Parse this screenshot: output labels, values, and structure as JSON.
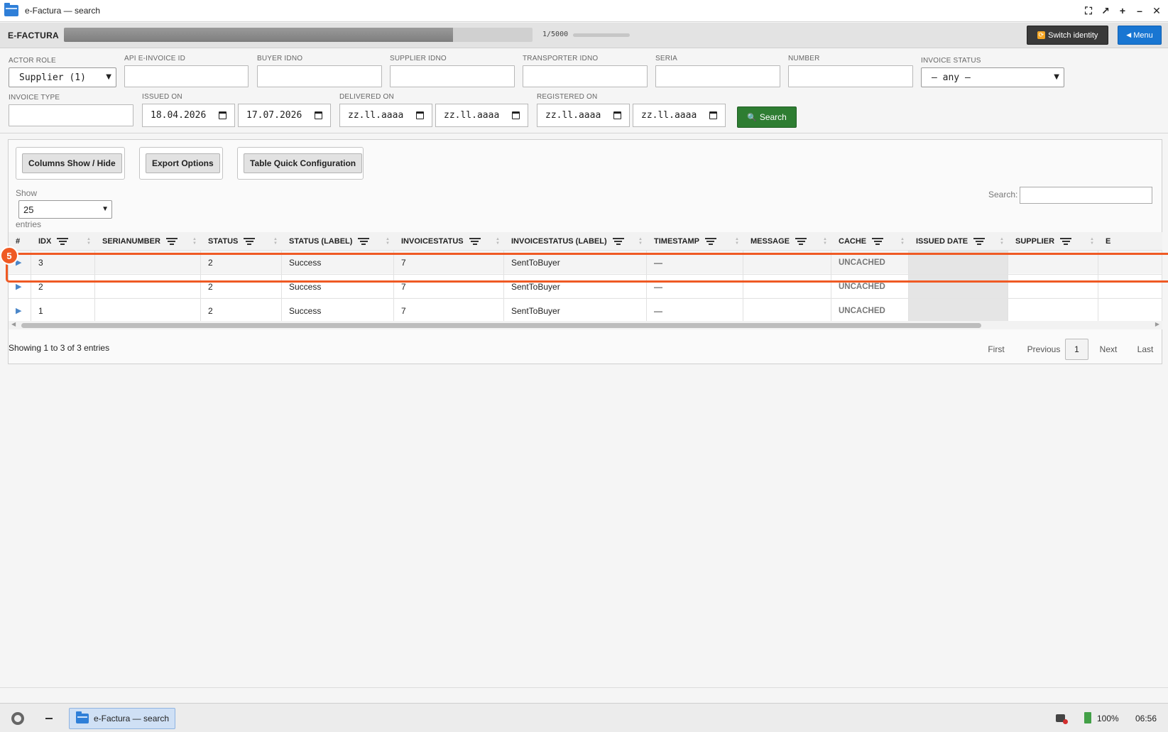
{
  "window": {
    "title": "e-Factura — search"
  },
  "appbar": {
    "brand": "E-FACTURA",
    "progress_fraction": 0.83,
    "counter": "1/5000",
    "switch_label": "Switch identity",
    "menu_label": "Menu"
  },
  "filters": {
    "actor_role": {
      "label": "ACTOR ROLE",
      "value": "Supplier (1)"
    },
    "api_invoice_id": {
      "label": "API E-INVOICE ID"
    },
    "buyer_idno": {
      "label": "BUYER IDNO"
    },
    "supplier_idno": {
      "label": "SUPPLIER IDNO"
    },
    "transporter_idno": {
      "label": "TRANSPORTER IDNO"
    },
    "seria": {
      "label": "SERIA"
    },
    "number": {
      "label": "NUMBER"
    },
    "invoice_status": {
      "label": "INVOICE STATUS",
      "value": "— any —"
    },
    "invoice_type": {
      "label": "INVOICE TYPE"
    },
    "issued_on": {
      "label": "ISSUED ON",
      "from": "18.04.2026",
      "to": "17.07.2026"
    },
    "delivered_on": {
      "label": "DELIVERED ON",
      "from": "zz.ll.aaaa",
      "to": "zz.ll.aaaa"
    },
    "registered_on": {
      "label": "REGISTERED ON",
      "from": "zz.ll.aaaa",
      "to": "zz.ll.aaaa"
    },
    "search_label": "Search"
  },
  "table": {
    "toolbar": {
      "columns": "Columns Show / Hide",
      "export": "Export Options",
      "quick": "Table Quick Configuration"
    },
    "show_label": "Show",
    "page_size": "25",
    "entries_label": "entries",
    "search_label": "Search:",
    "columns": [
      "#",
      "IDX",
      "SERIANUMBER",
      "STATUS",
      "STATUS (LABEL)",
      "INVOICESTATUS",
      "INVOICESTATUS (LABEL)",
      "TIMESTAMP",
      "MESSAGE",
      "CACHE",
      "ISSUED DATE",
      "SUPPLIER",
      "E"
    ],
    "rows": [
      {
        "expand": "▶",
        "idx": "3",
        "serianumber": "",
        "status": "2",
        "status_label": "Success",
        "invoicestatus": "7",
        "invoicestatus_label": "SentToBuyer",
        "timestamp": "—",
        "message": "",
        "cache": "UNCACHED"
      },
      {
        "expand": "▶",
        "idx": "2",
        "serianumber": "",
        "status": "2",
        "status_label": "Success",
        "invoicestatus": "7",
        "invoicestatus_label": "SentToBuyer",
        "timestamp": "—",
        "message": "",
        "cache": "UNCACHED"
      },
      {
        "expand": "▶",
        "idx": "1",
        "serianumber": "",
        "status": "2",
        "status_label": "Success",
        "invoicestatus": "7",
        "invoicestatus_label": "SentToBuyer",
        "timestamp": "—",
        "message": "",
        "cache": "UNCACHED"
      }
    ],
    "info": "Showing 1 to 3 of 3 entries",
    "pager": {
      "first": "First",
      "previous": "Previous",
      "current": "1",
      "next": "Next",
      "last": "Last"
    }
  },
  "annotation": {
    "badge": "5",
    "color": "#ef5a24"
  },
  "taskbar": {
    "task_label": "e-Factura — search",
    "battery": "100%",
    "clock": "06:56"
  },
  "colors": {
    "accent_blue": "#1976d2",
    "search_green": "#2e7d32",
    "switch_dark": "#3a3a3a"
  }
}
